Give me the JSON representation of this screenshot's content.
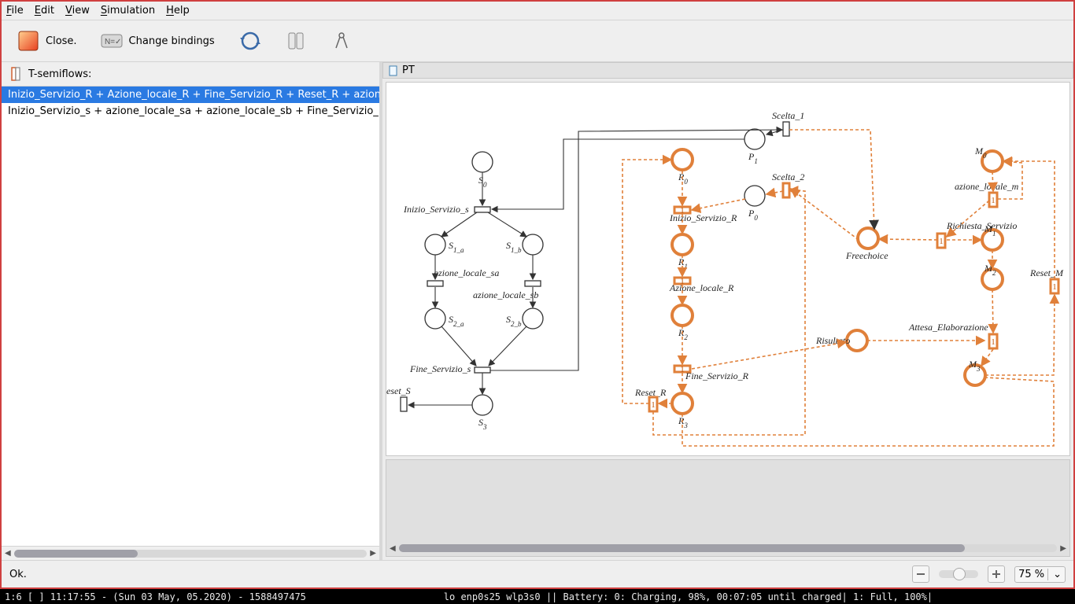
{
  "menu": {
    "file": "File",
    "edit": "Edit",
    "view": "View",
    "sim": "Simulation",
    "help": "Help"
  },
  "toolbar": {
    "close": "Close.",
    "chbind": "Change bindings"
  },
  "leftpane": {
    "title": "T-semiflows:",
    "items": [
      "Inizio_Servizio_R + Azione_locale_R + Fine_Servizio_R + Reset_R + azion",
      "Inizio_Servizio_s + azione_locale_sa + azione_locale_sb + Fine_Servizio_"
    ],
    "selected": 0
  },
  "rightpane": {
    "title": "PT"
  },
  "net": {
    "s0": "S",
    "s1a": "S",
    "s1b": "S",
    "s2a": "S",
    "s2b": "S",
    "s3": "S",
    "inizio_s": "Inizio_Servizio_s",
    "az_sa": "azione_locale_sa",
    "az_sb": "azione_locale_sb",
    "fine_s": "Fine_Servizio_s",
    "reset_s": "eset_S",
    "scelta1": "Scelta_1",
    "p1": "P",
    "scelta2": "Scelta_2",
    "p0": "P",
    "r0": "R",
    "r1": "R",
    "r2": "R",
    "r3": "R",
    "inizio_r": "Inizio_Servizio_R",
    "az_r": "Azione_locale_R",
    "fine_r": "Fine_Servizio_R",
    "reset_r": "Reset_R",
    "m0": "M",
    "m1": "M",
    "m2": "M",
    "m3": "M",
    "az_m": "azione_locale_m",
    "rich": "Richiesta_Servizio",
    "attesa": "Attesa_Elaborazione",
    "reset_m": "Reset_M",
    "freechoice": "Freechoice",
    "risultato": "Risultato"
  },
  "status": {
    "ok": "Ok."
  },
  "zoom": {
    "value": "75 %"
  },
  "deskbar": {
    "left": "1:6 [ ]    11:17:55 - (Sun 03 May, 05.2020) - 1588497475",
    "mid": "lo enp0s25 wlp3s0   ||   Battery: 0: Charging, 98%, 00:07:05 until charged| 1: Full, 100%|"
  }
}
